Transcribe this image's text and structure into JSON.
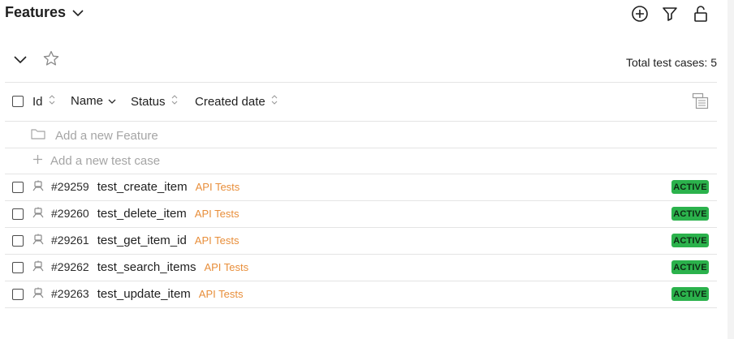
{
  "header": {
    "title": "Features",
    "icons": [
      "add-circle-icon",
      "filter-icon",
      "unlock-icon"
    ]
  },
  "toolbar": {
    "total_label": "Total test cases: 5"
  },
  "table": {
    "columns": [
      "Id",
      "Name",
      "Status",
      "Created date"
    ],
    "add_feature_label": "Add a new Feature",
    "add_test_case_label": "Add a new test case",
    "rows": [
      {
        "id": "#29259",
        "name": "test_create_item",
        "tag": "API Tests",
        "status": "ACTIVE"
      },
      {
        "id": "#29260",
        "name": "test_delete_item",
        "tag": "API Tests",
        "status": "ACTIVE"
      },
      {
        "id": "#29261",
        "name": "test_get_item_id",
        "tag": "API Tests",
        "status": "ACTIVE"
      },
      {
        "id": "#29262",
        "name": "test_search_items",
        "tag": "API Tests",
        "status": "ACTIVE"
      },
      {
        "id": "#29263",
        "name": "test_update_item",
        "tag": "API Tests",
        "status": "ACTIVE"
      }
    ]
  },
  "colors": {
    "badge_bg": "#2bb24c",
    "tag": "#e88e3a"
  }
}
